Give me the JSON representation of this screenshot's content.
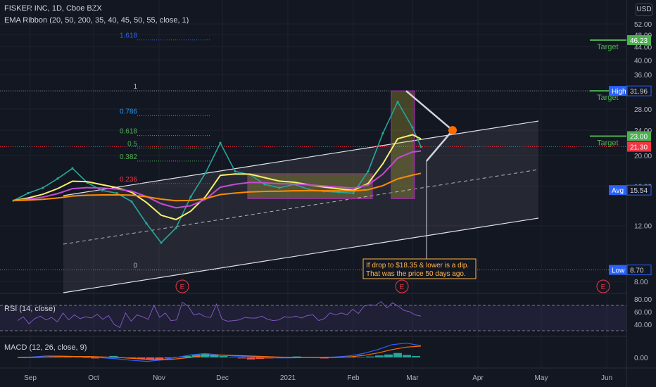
{
  "header": {
    "symbol_line": "FISKER INC, 1D, Cboe BZX",
    "indicator_line": "EMA Ribbon (20, 50, 200, 35, 40, 45, 50, 55, close, 1)",
    "currency": "USD"
  },
  "chart_data": {
    "type": "line",
    "title": "FISKER INC, 1D, Cboe BZX",
    "price_axis": {
      "scale": "log",
      "ticks": [
        52.0,
        48.0,
        44.0,
        40.0,
        36.0,
        32.0,
        28.0,
        24.0,
        20.0,
        16.0,
        12.0,
        8.0
      ],
      "tick_labels": [
        "52.00",
        "48.00",
        "44.00",
        "40.00",
        "36.00",
        "32.00",
        "28.00",
        "24.00",
        "20.00",
        "16.00",
        "12.00",
        "8.00"
      ]
    },
    "time_axis": {
      "labels": [
        "Sep",
        "Oct",
        "Nov",
        "Dec",
        "2021",
        "Feb",
        "Mar",
        "Apr",
        "May",
        "Jun"
      ]
    },
    "series": [
      {
        "name": "FISKER INC",
        "color": "#26a69a",
        "points": [
          [
            "2020-08-24",
            14.4
          ],
          [
            "2020-08-31",
            15.2
          ],
          [
            "2020-09-07",
            15.8
          ],
          [
            "2020-09-14",
            16.9
          ],
          [
            "2020-09-21",
            18.2
          ],
          [
            "2020-09-28",
            16.4
          ],
          [
            "2020-10-05",
            15.5
          ],
          [
            "2020-10-12",
            15.2
          ],
          [
            "2020-10-19",
            14.3
          ],
          [
            "2020-10-26",
            12.2
          ],
          [
            "2020-11-02",
            10.6
          ],
          [
            "2020-11-09",
            11.8
          ],
          [
            "2020-11-16",
            14.8
          ],
          [
            "2020-11-23",
            17.6
          ],
          [
            "2020-11-30",
            21.9
          ],
          [
            "2020-12-07",
            17.8
          ],
          [
            "2020-12-14",
            17.4
          ],
          [
            "2020-12-21",
            16.2
          ],
          [
            "2020-12-28",
            15.8
          ],
          [
            "2021-01-04",
            16.2
          ],
          [
            "2021-01-11",
            15.6
          ],
          [
            "2021-01-18",
            15.4
          ],
          [
            "2021-01-25",
            15.3
          ],
          [
            "2021-02-01",
            15.2
          ],
          [
            "2021-02-08",
            17.8
          ],
          [
            "2021-02-15",
            23.5
          ],
          [
            "2021-02-22",
            29.5
          ],
          [
            "2021-03-01",
            24.5
          ],
          [
            "2021-03-05",
            21.3
          ]
        ]
      }
    ],
    "ema_ribbon": [
      {
        "color": "#f7f06b"
      },
      {
        "color": "#c44bd4"
      },
      {
        "color": "#ff8c00"
      }
    ],
    "fibonacci": {
      "levels": [
        {
          "label": "1.618",
          "price": 46.3,
          "color": "#2962ff"
        },
        {
          "label": "1",
          "price": 31.96,
          "color": "#b2b5be"
        },
        {
          "label": "0.786",
          "price": 26.7,
          "color": "#2196f3"
        },
        {
          "label": "0.618",
          "price": 23.1,
          "color": "#4caf50"
        },
        {
          "label": "0.5",
          "price": 21.1,
          "color": "#4caf50"
        },
        {
          "label": "0.382",
          "price": 19.2,
          "color": "#4caf50"
        },
        {
          "label": "0.236",
          "price": 16.3,
          "color": "#f23645"
        },
        {
          "label": "0",
          "price": 8.7,
          "color": "#b2b5be"
        }
      ]
    },
    "price_labels": [
      {
        "text": "46.23",
        "price": 46.23,
        "color": "#4caf50"
      },
      {
        "text": "31.96",
        "price": 31.96,
        "color": "#4caf50"
      },
      {
        "text": "23.00",
        "price": 23.0,
        "color": "#4caf50"
      },
      {
        "text": "21.30",
        "price": 21.3,
        "color": "#f23645"
      },
      {
        "text": "High",
        "value": "31.96",
        "price": 31.96,
        "color": "#2962ff"
      },
      {
        "text": "Avg",
        "value": "15.54",
        "price": 15.54,
        "color": "#2962ff"
      },
      {
        "text": "Low",
        "value": "8.70",
        "price": 8.7,
        "color": "#2962ff"
      }
    ],
    "annotations": {
      "targets": [
        "Target",
        "Target",
        "Target"
      ],
      "note_line1": "If drop to $18.35 & lower is a dip.",
      "note_line2": "That was the price 50 days ago.",
      "earnings_marker": "E"
    },
    "rsi": {
      "title": "RSI (14, close)",
      "ticks": [
        80.0,
        60.0,
        40.0
      ],
      "tick_labels": [
        "80.00",
        "60.00",
        "40.00"
      ],
      "values": [
        46,
        52,
        41,
        49,
        53,
        47,
        51,
        44,
        58,
        47,
        55,
        49,
        52,
        50,
        56,
        48,
        54,
        40,
        35,
        58,
        45,
        55,
        52,
        48,
        70,
        51,
        58,
        46,
        47,
        75,
        69,
        55,
        57,
        52,
        51,
        72,
        48,
        45,
        46,
        47,
        51,
        50,
        50,
        53,
        48,
        46,
        47,
        52,
        51,
        53,
        50,
        54,
        55,
        46,
        49,
        58,
        55,
        58,
        55,
        64,
        57,
        69,
        71,
        70,
        76,
        66,
        74,
        69,
        62,
        60,
        55,
        53
      ]
    },
    "macd": {
      "title": "MACD (12, 26, close, 9)",
      "ticks": [
        0.0
      ],
      "tick_labels": [
        "0.00"
      ],
      "histogram": [
        -0.1,
        0.1,
        0.2,
        0.1,
        0.0,
        0.2,
        0.1,
        -0.1,
        -0.2,
        0.1,
        0.3,
        -0.1,
        -0.2,
        -0.3,
        -0.5,
        -0.4,
        -0.2,
        0.1,
        0.3,
        0.6,
        0.8,
        0.5,
        0.3,
        0.1,
        -0.2,
        -0.4,
        -0.3,
        -0.2,
        -0.1,
        0.1,
        0.2,
        0.1,
        -0.1,
        -0.2,
        0.1,
        0.1,
        0.2,
        0.1,
        0.2,
        0.4,
        0.6,
        0.9,
        0.5,
        0.3
      ],
      "macd_line": [
        0.0,
        0.1,
        0.3,
        0.3,
        0.2,
        0.1,
        -0.1,
        -0.3,
        -0.6,
        -0.8,
        -0.5,
        0.0,
        0.5,
        0.8,
        0.5,
        0.3,
        0.2,
        0.0,
        -0.1,
        -0.1,
        0.0,
        0.0,
        0.1,
        0.3,
        0.8,
        1.6,
        2.6,
        2.9,
        2.4
      ],
      "signal_line": [
        0.0,
        0.0,
        0.1,
        0.2,
        0.2,
        0.2,
        0.1,
        0.0,
        -0.2,
        -0.4,
        -0.5,
        -0.3,
        0.0,
        0.4,
        0.5,
        0.4,
        0.3,
        0.2,
        0.1,
        0.0,
        0.0,
        0.0,
        0.0,
        0.1,
        0.4,
        0.9,
        1.6,
        2.1,
        2.3
      ],
      "macd_color": "#2962ff",
      "signal_color": "#ff6d00"
    }
  }
}
